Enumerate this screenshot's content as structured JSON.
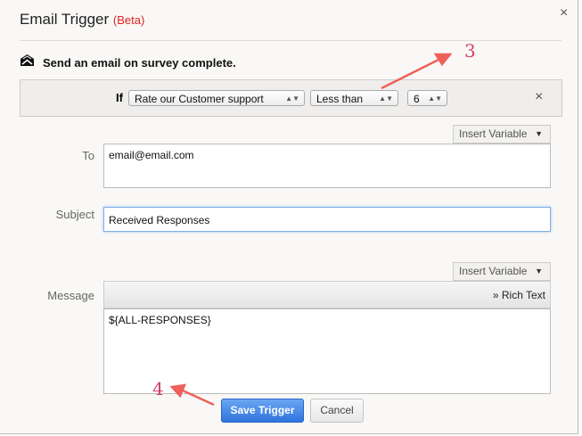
{
  "dialog": {
    "title": "Email Trigger",
    "badge": "(Beta)",
    "close_icon": "×",
    "subtitle": "Send an email on survey complete."
  },
  "condition": {
    "if_label": "If",
    "question": "Rate our Customer support",
    "operator": "Less than",
    "value": "6",
    "remove_icon": "×"
  },
  "form": {
    "insert_variable": "Insert Variable",
    "to_label": "To",
    "to_value": "email@email.com",
    "subject_label": "Subject",
    "subject_value": "Received Responses",
    "message_label": "Message",
    "rich_text": "» Rich Text",
    "message_value": "${ALL-RESPONSES}"
  },
  "buttons": {
    "save": "Save Trigger",
    "cancel": "Cancel"
  },
  "annotations": {
    "a3": "3",
    "a4": "4"
  },
  "colors": {
    "accent": "#3d83e6",
    "beta": "#e02020",
    "annotation": "#f0605a"
  }
}
